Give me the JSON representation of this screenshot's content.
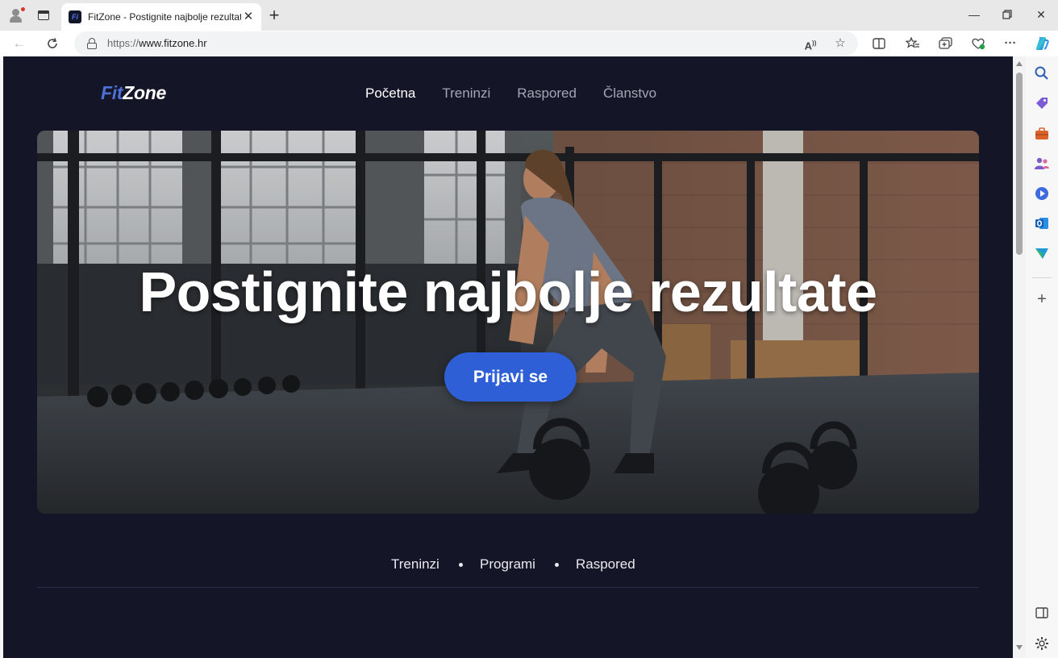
{
  "browser": {
    "tab_title": "FitZone - Postignite najbolje rezultate",
    "url_protocol": "https://",
    "url_host": "www.fitzone.hr",
    "favicon_text": "Fi"
  },
  "site": {
    "logo_fit": "Fit",
    "logo_zone": "Zone",
    "nav": [
      {
        "label": "Početna",
        "active": true
      },
      {
        "label": "Treninzi",
        "active": false
      },
      {
        "label": "Raspored",
        "active": false
      },
      {
        "label": "Članstvo",
        "active": false
      }
    ],
    "hero_title": "Postignite najbolje rezultate",
    "cta_label": "Prijavi se",
    "subnav": [
      "Treninzi",
      "Programi",
      "Raspored"
    ]
  },
  "colors": {
    "page_background": "#141627",
    "accent": "#2e5fd6",
    "logo_accent": "#4e6fd6"
  },
  "icons": {
    "tabbar": [
      "profile-icon",
      "tab-actions-icon",
      "close-icon",
      "new-tab-icon"
    ],
    "window": [
      "minimize-icon",
      "maximize-icon",
      "close-window-icon"
    ],
    "toolbar": [
      "back-icon",
      "refresh-icon",
      "lock-icon",
      "read-aloud-icon",
      "favorite-star-icon",
      "split-screen-icon",
      "favorites-icon",
      "collections-icon",
      "browser-essentials-icon",
      "more-icon",
      "copilot-icon"
    ],
    "sidebar": [
      "search-icon",
      "shopping-tag-icon",
      "tools-briefcase-icon",
      "people-icon",
      "games-icon",
      "outlook-icon",
      "send-icon",
      "add-icon",
      "sidebar-toggle-icon",
      "settings-icon"
    ]
  }
}
